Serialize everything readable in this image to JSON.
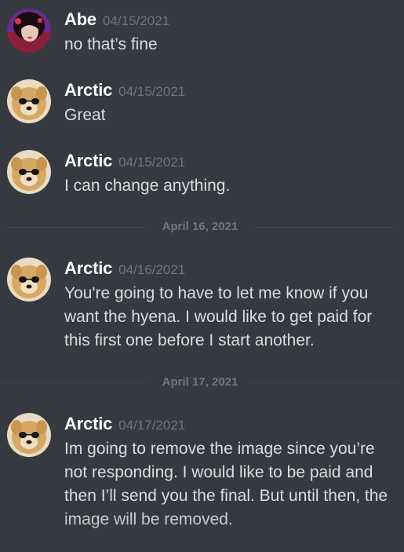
{
  "messages": [
    {
      "author": "Abe",
      "timestamp": "04/15/2021",
      "text": "no that’s fine",
      "avatar": "abe-avatar"
    },
    {
      "author": "Arctic",
      "timestamp": "04/15/2021",
      "text": "Great",
      "avatar": "dog-avatar"
    },
    {
      "author": "Arctic",
      "timestamp": "04/15/2021",
      "text": "I can change anything.",
      "avatar": "dog-avatar"
    },
    {
      "author": "Arctic",
      "timestamp": "04/16/2021",
      "text": "You're going to have to let me know if you want the hyena. I would like to get paid for this first one before I start another.",
      "avatar": "dog-avatar"
    },
    {
      "author": "Arctic",
      "timestamp": "04/17/2021",
      "text": "Im going to remove the image since you’re not responding. I would like to be paid and then I’ll send you the final. But until then, the image will be removed.",
      "avatar": "dog-avatar"
    }
  ],
  "dividers": [
    {
      "label": "April 16, 2021"
    },
    {
      "label": "April 17, 2021"
    }
  ],
  "colors": {
    "background": "#36393f",
    "author": "#ffffff",
    "timestamp": "#72767d",
    "text": "#dcddde",
    "divider": "#42454a"
  }
}
